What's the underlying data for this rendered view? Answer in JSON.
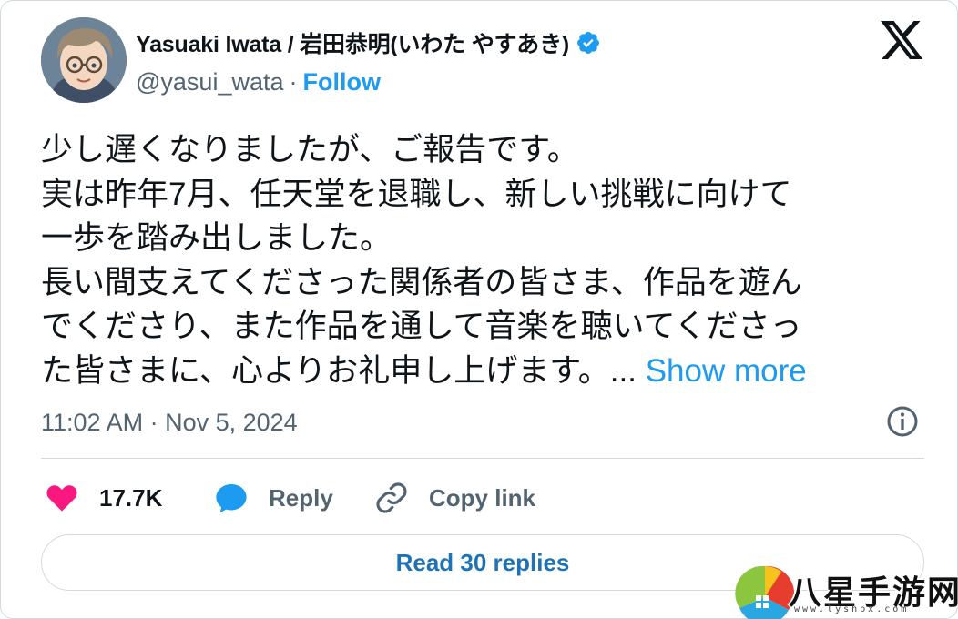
{
  "author": {
    "display_name": "Yasuaki Iwata / 岩田恭明(いわた やすあき)",
    "handle": "@yasui_wata",
    "separator": "·",
    "follow_label": "Follow",
    "verified": true
  },
  "tweet": {
    "lines": [
      "少し遅くなりましたが、ご報告です。",
      "実は昨年7月、任天堂を退職し、新しい挑戦に向けて",
      "一歩を踏み出しました。",
      "長い間支えてくださった関係者の皆さま、作品を遊ん",
      "でくださり、また作品を通して音楽を聴いてくださっ",
      "た皆さまに、心よりお礼申し上げます。"
    ],
    "ellipsis": "...",
    "show_more_label": "Show more",
    "timestamp": "11:02 AM · Nov 5, 2024"
  },
  "actions": {
    "likes_count": "17.7K",
    "reply_label": "Reply",
    "copy_link_label": "Copy link"
  },
  "read_replies_label": "Read 30 replies",
  "watermark": {
    "text": "八星手游网",
    "url": "www.lyshbx.com"
  },
  "colors": {
    "accent": "#1d9bf0",
    "like": "#f91880",
    "muted": "#536471",
    "border": "#cfd9de"
  },
  "icons": [
    "x-logo-icon",
    "verified-badge-icon",
    "info-icon",
    "heart-icon",
    "reply-bubble-icon",
    "link-icon"
  ]
}
